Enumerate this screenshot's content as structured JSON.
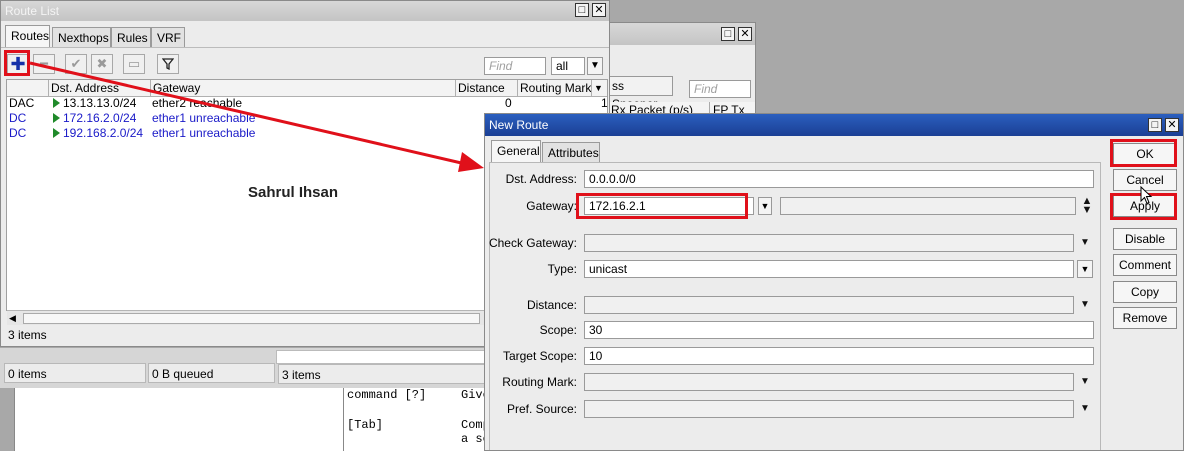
{
  "route_list": {
    "title": "Route List",
    "tabs": [
      "Routes",
      "Nexthops",
      "Rules",
      "VRF"
    ],
    "find_placeholder": "Find",
    "filter_value": "all",
    "columns": [
      "Dst. Address",
      "Gateway",
      "Distance",
      "Routing Mark"
    ],
    "rows": [
      {
        "flag": "DAC",
        "dst": "13.13.13.0/24",
        "gateway": "ether2 reachable",
        "distance": "0",
        "mark": "1"
      },
      {
        "flag": "DC",
        "dst": "172.16.2.0/24",
        "gateway": "ether1 unreachable",
        "distance": "",
        "mark": ""
      },
      {
        "flag": "DC",
        "dst": "192.168.2.0/24",
        "gateway": "ether1 unreachable",
        "distance": "",
        "mark": ""
      }
    ],
    "item_count": "3 items"
  },
  "bottom_status": {
    "left": "0 items",
    "middle": "0 B queued",
    "right": "3 items"
  },
  "background_window": {
    "snooper_label": "ss Snooper",
    "find_placeholder": "Find",
    "col_rx": "Rx Packet (p/s)",
    "col_fp": "FP Tx"
  },
  "terminal": {
    "line1_cmd": "command [?]",
    "line1_desc": "Give",
    "line2_cmd": "[Tab]",
    "line2_desc": "Comp",
    "line3_desc": "a sc"
  },
  "watermark": "Sahrul Ihsan",
  "new_route": {
    "title": "New Route",
    "tabs": [
      "General",
      "Attributes"
    ],
    "fields": {
      "dst_label": "Dst. Address:",
      "dst_value": "0.0.0.0/0",
      "gateway_label": "Gateway:",
      "gateway_value": "172.16.2.1",
      "check_gateway_label": "Check Gateway:",
      "type_label": "Type:",
      "type_value": "unicast",
      "distance_label": "Distance:",
      "scope_label": "Scope:",
      "scope_value": "30",
      "target_scope_label": "Target Scope:",
      "target_scope_value": "10",
      "routing_mark_label": "Routing Mark:",
      "pref_source_label": "Pref. Source:"
    },
    "buttons": [
      "OK",
      "Cancel",
      "Apply",
      "Disable",
      "Comment",
      "Copy",
      "Remove"
    ]
  },
  "colors": {
    "highlight": "#e0101a",
    "title_active": "#1b3f94",
    "dynamic_text": "#1a1ac8",
    "active_flag": "#1f8a2a"
  }
}
